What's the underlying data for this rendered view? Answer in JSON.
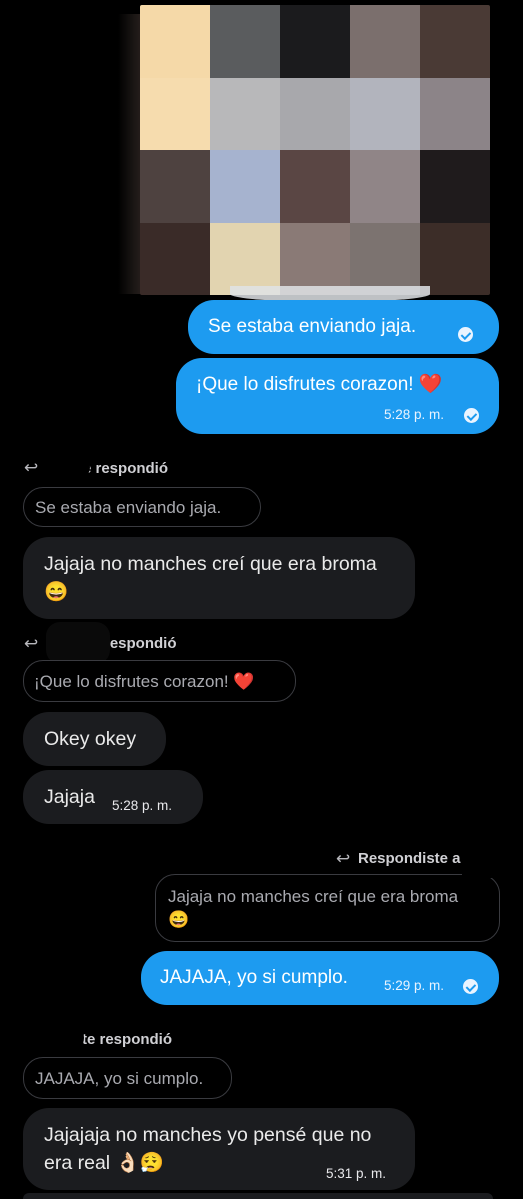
{
  "image": {
    "colors": [
      "#f5d9a8",
      "#5a5c5e",
      "#1b1b1d",
      "#7b6f6d",
      "#4a3a35",
      "#f6dcae",
      "#b8b8ba",
      "#a8a8ac",
      "#b2b4bd",
      "#8c8488",
      "#4e4240",
      "#a6b3cf",
      "#5a4644",
      "#908587",
      "#1f1b1c",
      "#3a2b28",
      "#e2d4b0",
      "#8a7a76",
      "#7c7370",
      "#3c2d28"
    ]
  },
  "messages": {
    "m1": {
      "text": "Se estaba enviando jaja."
    },
    "m2": {
      "text": "¡Que lo disfrutes corazon! ",
      "emoji": "❤️",
      "time": "5:28 p. m."
    },
    "r1": {
      "label": "te respondió",
      "quote": "Se estaba enviando jaja."
    },
    "m3": {
      "text": "Jajaja no manches creí que era broma ",
      "emoji": "😄"
    },
    "r2": {
      "label": "respondió",
      "quote": "¡Que lo disfrutes corazon! ",
      "quote_emoji": "❤️"
    },
    "m4": {
      "text": "Okey okey"
    },
    "m5": {
      "text": "Jajaja",
      "time": "5:28 p. m."
    },
    "r3": {
      "label": "Respondiste a",
      "quote": "Jajaja no manches creí que era broma ",
      "quote_emoji": "😄"
    },
    "m6": {
      "text": "JAJAJA, yo si cumplo.",
      "time": "5:29 p. m."
    },
    "r4": {
      "label": "te respondió",
      "quote": "JAJAJA, yo si cumplo."
    },
    "m7": {
      "text": "Jajajaja no manches yo pensé que no era real ",
      "emoji": "👌🏻😮‍💨",
      "time": "5:31 p. m."
    }
  },
  "icons": {
    "reply": "↩",
    "read_receipt": "check-circle-icon"
  }
}
